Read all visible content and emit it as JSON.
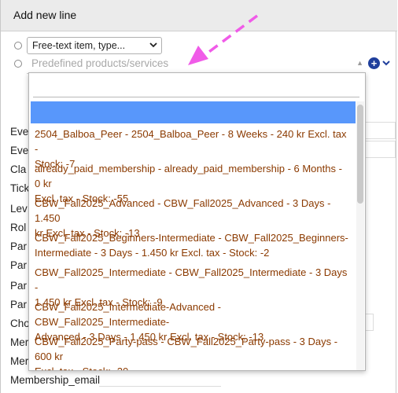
{
  "header": {
    "title": "Add new line"
  },
  "free_text_select": {
    "value": "Free-text item, type..."
  },
  "predefined": {
    "placeholder": "Predefined products/services"
  },
  "background_labels": [
    "Eve",
    "Eve",
    "Cla",
    "Tick",
    "Lev",
    "Rol",
    "Par",
    "Par",
    "Par",
    "Par",
    "Cho",
    "Mer",
    "Mer",
    "Membership_email"
  ],
  "dropdown": {
    "search_value": "",
    "options": [
      {
        "line1": "2504_Balboa_Peer - 2504_Balboa_Peer - 8 Weeks - 240 kr Excl. tax -",
        "line2": "Stock: -7"
      },
      {
        "line1": "already_paid_membership - already_paid_membership - 6 Months - 0 kr",
        "line2": "Excl. tax - Stock: -55"
      },
      {
        "line1": "CBW_Fall2025_Advanced - CBW_Fall2025_Advanced - 3 Days - 1.450",
        "line2": "kr Excl. tax - Stock: -13"
      },
      {
        "line1": "CBW_Fall2025_Beginners-Intermediate - CBW_Fall2025_Beginners-",
        "line2": "Intermediate - 3 Days - 1.450 kr Excl. tax - Stock: -2"
      },
      {
        "line1": "CBW_Fall2025_Intermediate - CBW_Fall2025_Intermediate - 3 Days -",
        "line2": "1.450 kr Excl. tax - Stock: -9"
      },
      {
        "line1": "CBW_Fall2025_Intermediate-Advanced - CBW_Fall2025_Intermediate-",
        "line2": "Advanced - 3 Days - 1.450 kr Excl. tax - Stock: -13"
      },
      {
        "line1": "CBW_Fall2025_Party-pass - CBW_Fall2025_Party-pass - 3 Days - 600 kr",
        "line2": "Excl. tax - Stock: -20"
      }
    ]
  },
  "icons": {
    "add": "plus-circle-icon",
    "expand": "chevron-down-icon",
    "collapse": "caret-up-icon",
    "annotation": "dashed-arrow-icon"
  },
  "colors": {
    "option_text": "#8b3a00",
    "highlight": "#5897fb",
    "add_button": "#1f3f9c",
    "annotation_arrow": "#f05be8"
  }
}
